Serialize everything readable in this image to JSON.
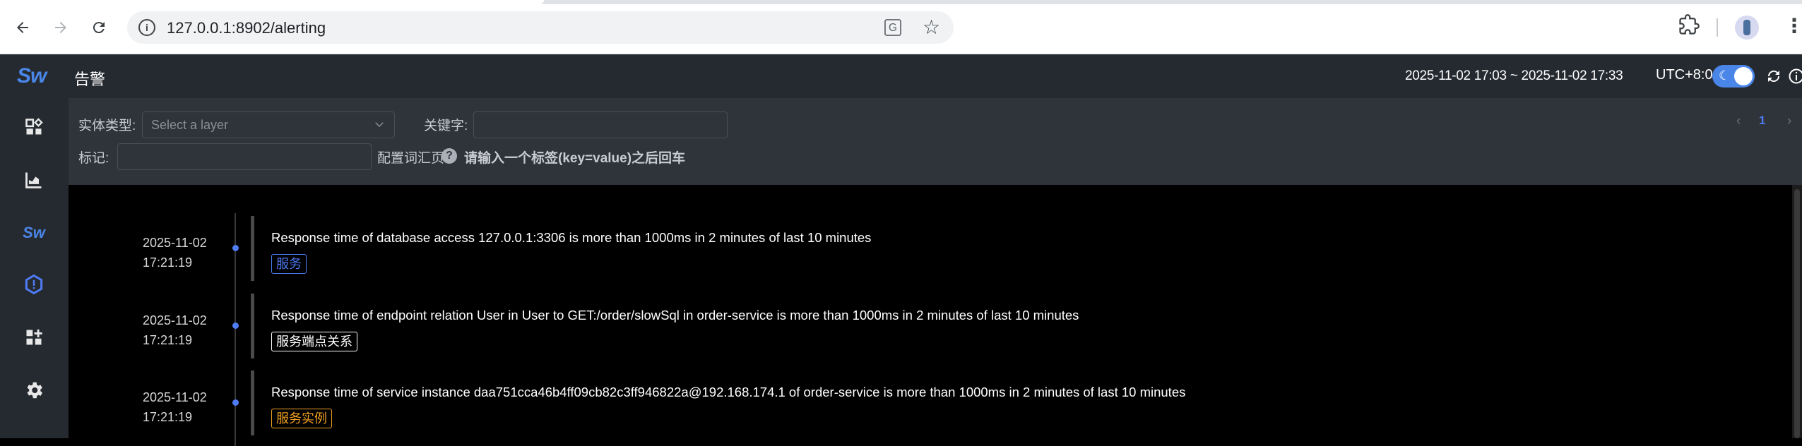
{
  "browser": {
    "url": "127.0.0.1:8902/alerting",
    "back_icon": "arrow-left-icon",
    "forward_icon": "arrow-right-icon",
    "reload_icon": "reload-icon"
  },
  "app": {
    "logo": "Sw",
    "page_title": "告警",
    "time_range": "2025-11-02 17:03 ~ 2025-11-02 17:33",
    "timezone": "UTC+8:0",
    "accent_color": "#4f7cf5"
  },
  "sidebar": {
    "items": [
      {
        "name": "dashboard-icon",
        "active": false
      },
      {
        "name": "chart-icon",
        "active": false
      },
      {
        "name": "sw-logo-icon",
        "active": false
      },
      {
        "name": "alert-icon",
        "active": true
      },
      {
        "name": "add-widget-icon",
        "active": false
      },
      {
        "name": "settings-icon",
        "active": false
      }
    ]
  },
  "filters": {
    "entity_type_label": "实体类型:",
    "entity_type_placeholder": "Select a layer",
    "keyword_label": "关键字:",
    "keyword_value": "",
    "tags_label": "标记:",
    "tags_value": "",
    "config_label": "配置词汇页",
    "tags_hint": "请输入一个标签(key=value)之后回车"
  },
  "pagination": {
    "current_page": "1",
    "prev_icon": "chevron-left-icon",
    "next_icon": "chevron-right-icon"
  },
  "alerts": [
    {
      "date": "2025-11-02",
      "time": "17:21:19",
      "message": "Response time of database access 127.0.0.1:3306 is more than 1000ms in 2 minutes of last 10 minutes",
      "tag": "服务",
      "tag_color": "#4f7cf5"
    },
    {
      "date": "2025-11-02",
      "time": "17:21:19",
      "message": "Response time of endpoint relation User in User to GET:/order/slowSql in order-service is more than 1000ms in 2 minutes of last 10 minutes",
      "tag": "服务端点关系",
      "tag_color": "#ffffff"
    },
    {
      "date": "2025-11-02",
      "time": "17:21:19",
      "message": "Response time of service instance daa751cca46b4ff09cb82c3ff946822a@192.168.174.1 of order-service is more than 1000ms in 2 minutes of last 10 minutes",
      "tag": "服务实例",
      "tag_color": "#f0a020"
    }
  ]
}
